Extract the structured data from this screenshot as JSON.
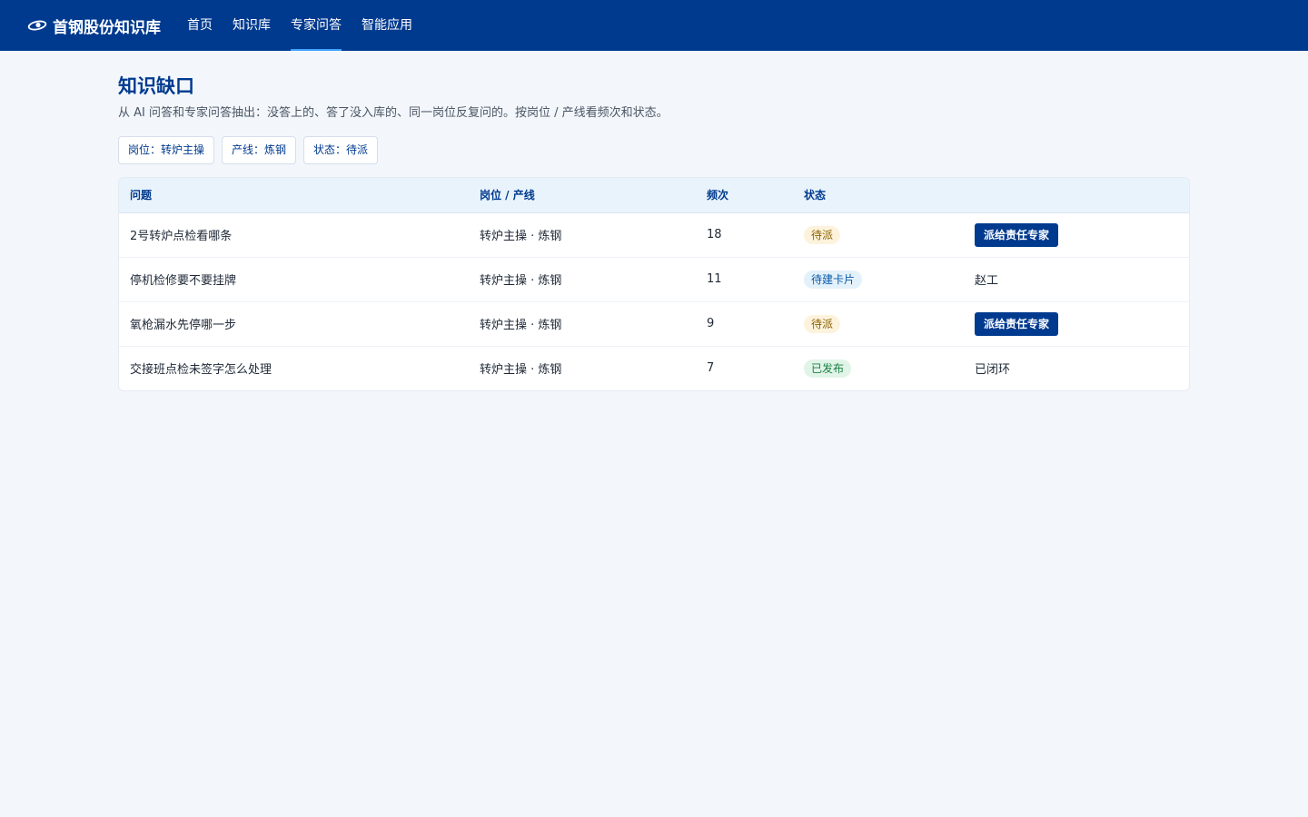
{
  "app": {
    "brand": "首钢股份知识库",
    "logo_icon": "shougang-logo-icon",
    "colors": {
      "primary": "#003a8f",
      "accent": "#3ea2ff",
      "page_bg": "#f3f7fc"
    }
  },
  "nav": {
    "items": [
      {
        "label": "首页",
        "active": false
      },
      {
        "label": "知识库",
        "active": false
      },
      {
        "label": "专家问答",
        "active": true
      },
      {
        "label": "智能应用",
        "active": false
      }
    ]
  },
  "page": {
    "title": "知识缺口",
    "description": "从 AI 问答和专家问答抽出：没答上的、答了没入库的、同一岗位反复问的。按岗位 / 产线看频次和状态。"
  },
  "filters": [
    {
      "label": "岗位：转炉主操"
    },
    {
      "label": "产线：炼钢"
    },
    {
      "label": "状态：待派"
    }
  ],
  "table": {
    "columns": [
      "问题",
      "岗位 / 产线",
      "频次",
      "状态",
      ""
    ],
    "rows": [
      {
        "question": "2号转炉点检看哪条",
        "post_line": "转炉主操 · 炼钢",
        "frequency": "18",
        "status": "待派",
        "status_type": "pending",
        "action_type": "button",
        "action": "派给责任专家"
      },
      {
        "question": "停机检修要不要挂牌",
        "post_line": "转炉主操 · 炼钢",
        "frequency": "11",
        "status": "待建卡片",
        "status_type": "card",
        "action_type": "text",
        "action": "赵工"
      },
      {
        "question": "氧枪漏水先停哪一步",
        "post_line": "转炉主操 · 炼钢",
        "frequency": "9",
        "status": "待派",
        "status_type": "pending",
        "action_type": "button",
        "action": "派给责任专家"
      },
      {
        "question": "交接班点检未签字怎么处理",
        "post_line": "转炉主操 · 炼钢",
        "frequency": "7",
        "status": "已发布",
        "status_type": "published",
        "action_type": "text",
        "action": "已闭环"
      }
    ]
  }
}
